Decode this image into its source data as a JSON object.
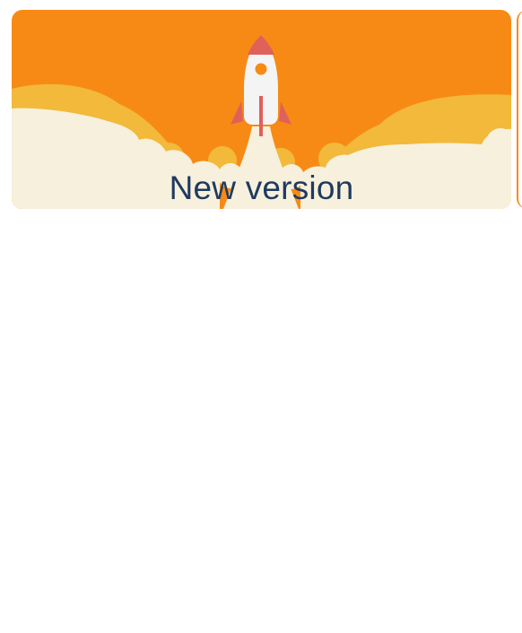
{
  "banner": {
    "title": "New version",
    "illustration": "rocket-launch",
    "colors": {
      "sky": "#f78a15",
      "cloud_back": "#f2b93b",
      "cloud_front": "#f7f0dc",
      "title": "#1f3a5f",
      "rocket_body": "#f4f4f4",
      "rocket_fins": "#e0605a"
    }
  }
}
